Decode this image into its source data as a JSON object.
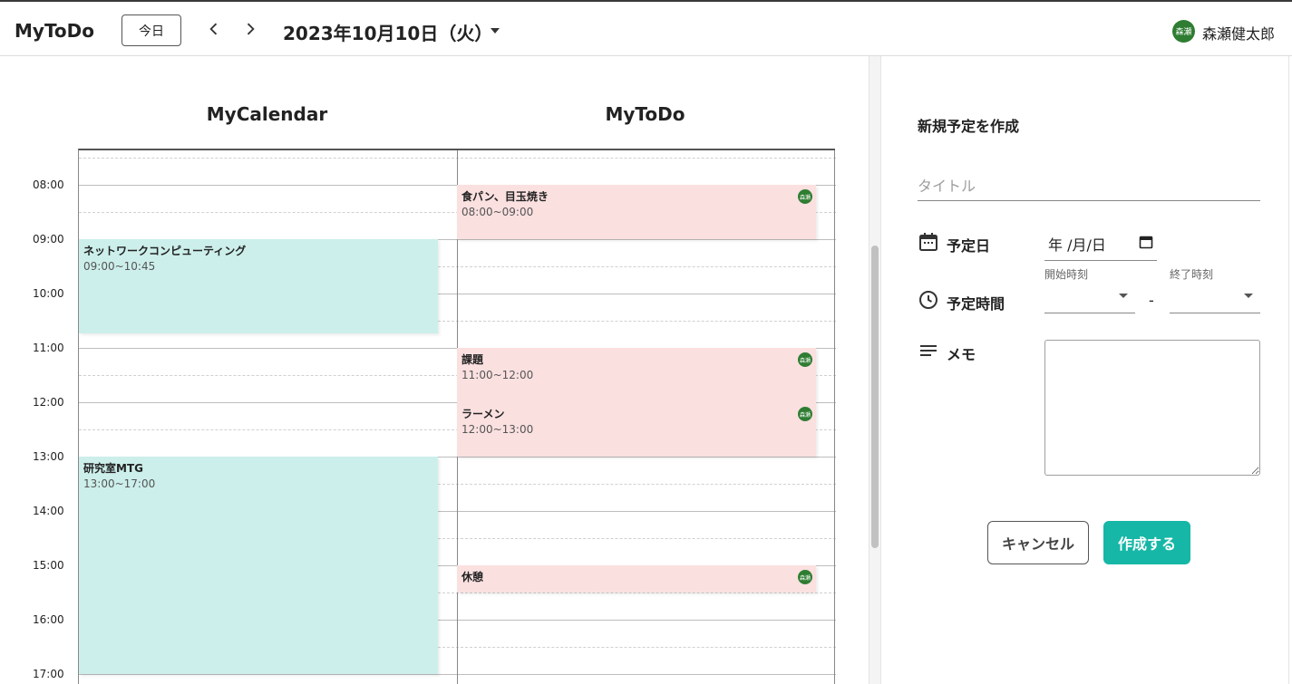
{
  "header": {
    "app_title": "MyToDo",
    "today_label": "今日",
    "prev_icon": "chevron-left-icon",
    "next_icon": "chevron-right-icon",
    "current_date": "2023年10月10日（火）",
    "user_avatar_text": "森瀬",
    "user_name": "森瀬健太郎"
  },
  "columns": {
    "calendar_title": "MyCalendar",
    "todo_title": "MyToDo"
  },
  "time_labels": [
    "08:00",
    "09:00",
    "10:00",
    "11:00",
    "12:00",
    "13:00",
    "14:00",
    "15:00",
    "16:00",
    "17:00"
  ],
  "calendar_events": [
    {
      "title": "ネットワークコンピューティング",
      "time": "09:00~10:45"
    },
    {
      "title": "研究室MTG",
      "time": "13:00~17:00"
    }
  ],
  "todo_events": [
    {
      "title": "食パン、目玉焼き",
      "time": "08:00~09:00",
      "badge": "森瀬"
    },
    {
      "title": "課題",
      "time": "11:00~12:00",
      "badge": "森瀬"
    },
    {
      "title": "ラーメン",
      "time": "12:00~13:00",
      "badge": "森瀬"
    },
    {
      "title": "休憩",
      "time": "",
      "badge": "森瀬"
    }
  ],
  "form": {
    "heading": "新規予定を作成",
    "title_placeholder": "タイトル",
    "date_label": "予定日",
    "date_value": "年 /月/日",
    "time_label": "予定時間",
    "start_label": "開始時刻",
    "end_label": "終了時刻",
    "time_separator": "-",
    "memo_label": "メモ",
    "cancel_label": "キャンセル",
    "create_label": "作成する"
  },
  "colors": {
    "calendar_event": "#ccefeb",
    "todo_event": "#fbe0e0",
    "avatar": "#2e7d32",
    "primary_button": "#16b7a6"
  }
}
